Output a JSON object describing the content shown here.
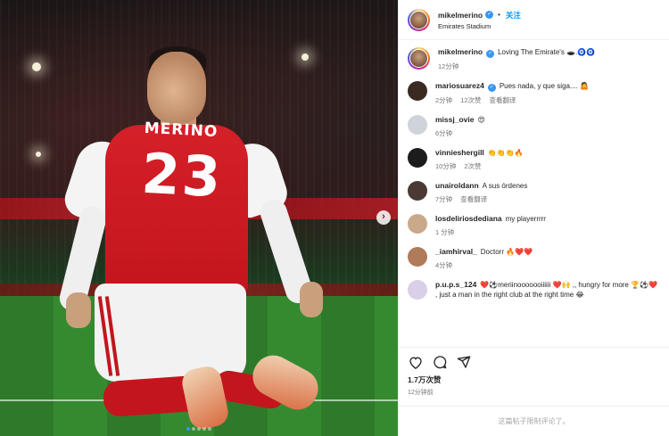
{
  "media": {
    "jersey_name": "MERINO",
    "jersey_number": "23",
    "next_icon": "chevron-right-icon",
    "carousel_dots": 5,
    "active_dot": 0
  },
  "post_header": {
    "username": "mikelmerino",
    "follow_label": "关注",
    "separator": "•",
    "location": "Emirates Stadium"
  },
  "caption": {
    "username": "mikelmerino",
    "text": "Loving The Emirate's 🕳️.🧿🧿",
    "time": "12分钟"
  },
  "comments": [
    {
      "username": "mariosuarez4",
      "verified": true,
      "text": "Pues nada, y que siga.... 🤷",
      "time": "2分钟",
      "likes": "12次赞",
      "translate": "查看翻译",
      "avatar_color": "#3b2a22"
    },
    {
      "username": "missj_ovie",
      "verified": false,
      "text": "😍",
      "time": "6分钟",
      "likes": "",
      "translate": "",
      "avatar_color": "#cfd3da"
    },
    {
      "username": "vinnieshergill",
      "verified": false,
      "text": "👏👏👏🔥",
      "time": "10分钟",
      "likes": "2次赞",
      "translate": "",
      "avatar_color": "#1c1c1c"
    },
    {
      "username": "unairoldann",
      "verified": false,
      "text": "A sus órdenes",
      "time": "7分钟",
      "likes": "",
      "translate": "查看翻译",
      "avatar_color": "#4a3a33"
    },
    {
      "username": "losdeliriosdediana",
      "verified": false,
      "text": "my playerrrrr",
      "time": "1 分钟",
      "likes": "",
      "translate": "",
      "avatar_color": "#c9a98a"
    },
    {
      "username": "_iamhirval_",
      "verified": false,
      "text": "Doctorr 🔥❤️❤️",
      "time": "4分钟",
      "likes": "",
      "translate": "",
      "avatar_color": "#b07b5a"
    },
    {
      "username": "p.u.p.s_124",
      "verified": false,
      "text": "❤️⚽meriinooooooiiiiii ❤️🙌 ,, hungry for more 🏆⚽❤️ , just a man in the right club at the right time 😂",
      "time": "",
      "likes": "",
      "translate": "",
      "avatar_color": "#d9cfe8"
    }
  ],
  "actions": {
    "icons": [
      "heart-icon",
      "comment-icon",
      "share-icon"
    ],
    "likes_count": "1.7万次赞",
    "posted_time": "12分钟前"
  },
  "footer": {
    "comments_limited": "这篇帖子限制评论了。"
  },
  "colors": {
    "accent_blue": "#0095f6",
    "verified_blue": "#3897f0",
    "muted_text": "#737373",
    "arsenal_red": "#d52028"
  }
}
